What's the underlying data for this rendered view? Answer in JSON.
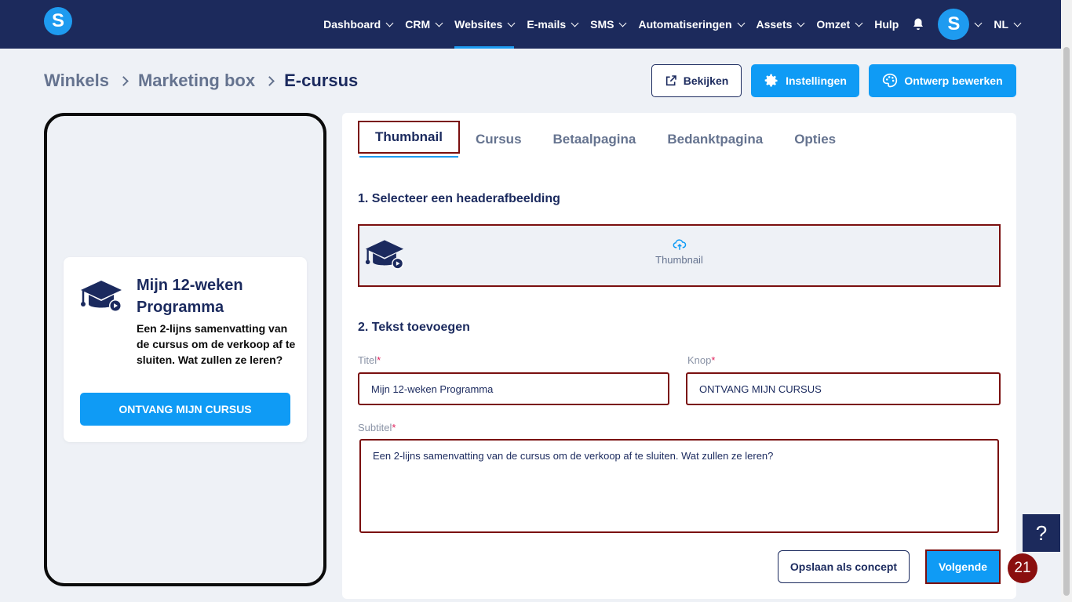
{
  "nav": {
    "logo_letter": "S",
    "items": [
      {
        "label": "Dashboard",
        "dropdown": true
      },
      {
        "label": "CRM",
        "dropdown": true
      },
      {
        "label": "Websites",
        "dropdown": true,
        "active": true
      },
      {
        "label": "E-mails",
        "dropdown": true
      },
      {
        "label": "SMS",
        "dropdown": true
      },
      {
        "label": "Automatiseringen",
        "dropdown": true
      },
      {
        "label": "Assets",
        "dropdown": true
      },
      {
        "label": "Omzet",
        "dropdown": true
      },
      {
        "label": "Hulp",
        "dropdown": false
      }
    ],
    "avatar_letter": "S",
    "language": "NL"
  },
  "breadcrumb": {
    "items": [
      "Winkels",
      "Marketing box",
      "E-cursus"
    ]
  },
  "header_buttons": {
    "view": "Bekijken",
    "settings": "Instellingen",
    "design": "Ontwerp bewerken"
  },
  "preview": {
    "title": "Mijn 12-weken Programma",
    "summary": "Een 2-lijns samenvatting van de cursus om de verkoop af te sluiten. Wat zullen ze leren?",
    "button": "ONTVANG MIJN CURSUS"
  },
  "tabs": [
    "Thumbnail",
    "Cursus",
    "Betaalpagina",
    "Bedanktpagina",
    "Opties"
  ],
  "editor": {
    "section1": "1. Selecteer een headerafbeelding",
    "upload_label": "Thumbnail",
    "section2": "2. Tekst toevoegen",
    "title_label": "Titel",
    "title_value": "Mijn 12-weken Programma",
    "button_label": "Knop",
    "button_value": "ONTVANG MIJN CURSUS",
    "subtitle_label": "Subtitel",
    "subtitle_value": "Een 2-lijns samenvatting van de cursus om de verkoop af te sluiten. Wat zullen ze leren?",
    "required_mark": "*",
    "draft_button": "Opslaan als concept",
    "next_button": "Volgende"
  },
  "step_badge": "21",
  "help_label": "?",
  "colors": {
    "nav_bg": "#1c2a5c",
    "accent": "#0f9bf5",
    "highlight": "#7a0f0f",
    "badge": "#8a0f0f"
  }
}
